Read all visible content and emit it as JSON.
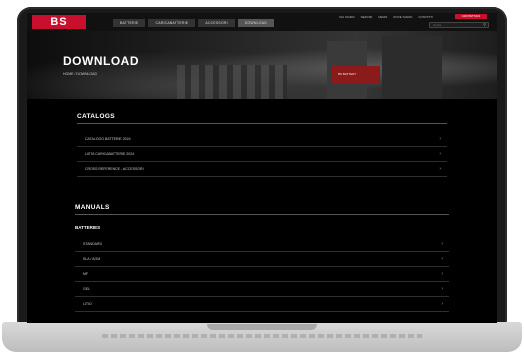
{
  "brand": {
    "logo_text": "BS",
    "accent": "#c8102e"
  },
  "nav": {
    "tabs": [
      "BATTERIE",
      "CARICABATTERIE",
      "ACCESSORI",
      "DOWNLOAD"
    ],
    "util_links": [
      "CHI SIAMO",
      "SERVIZI",
      "NEWS",
      "DOVE SIAMO",
      "CONTATTI"
    ],
    "contact_label": "CONTATTACI",
    "search_placeholder": "Cerca",
    "search_icon": "search-icon"
  },
  "hero": {
    "title": "DOWNLOAD",
    "breadcrumb": "HOME  /  DOWNLOAD",
    "crate_label": "BS BATTERY"
  },
  "catalog": {
    "title": "CATALOGS",
    "items": [
      "CATALOGO BATTERIE 2024",
      "LISTA CARICABATTERIE 2024",
      "CROSS REFERENCE - ACCESSORI",
      "CATALOGO ACCESSORI 2024"
    ]
  },
  "manuals": {
    "title": "MANUALS",
    "subtitle": "BATTERIES",
    "items": [
      "STANDARD",
      "SLA / AGM",
      "MF",
      "GEL",
      "LITIO"
    ]
  }
}
